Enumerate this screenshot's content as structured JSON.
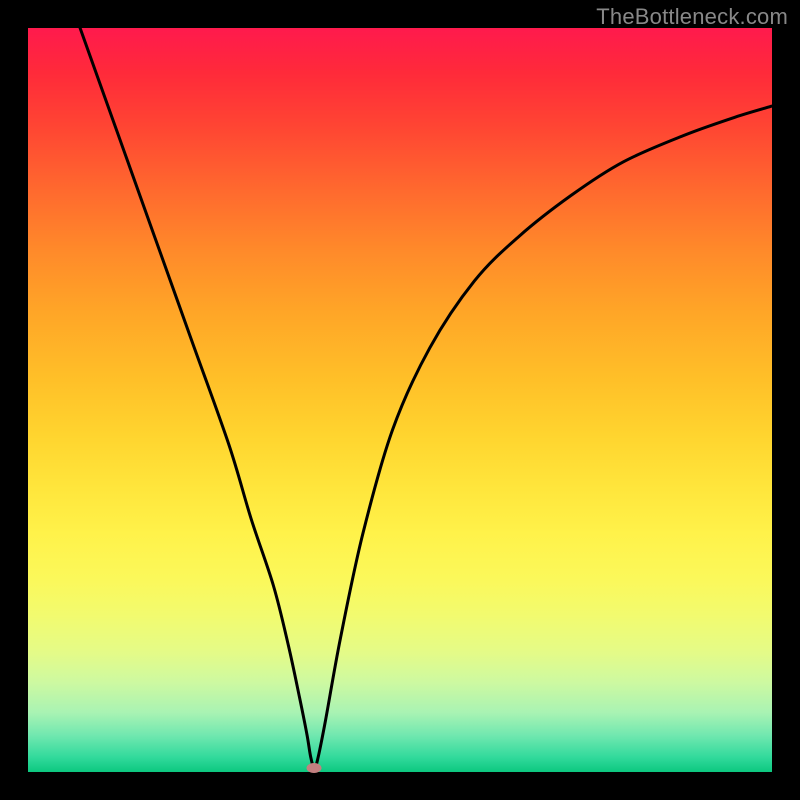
{
  "watermark": "TheBottleneck.com",
  "chart_data": {
    "type": "line",
    "title": "",
    "xlabel": "",
    "ylabel": "",
    "xlim": [
      0,
      100
    ],
    "ylim": [
      0,
      100
    ],
    "series": [
      {
        "name": "curve",
        "x": [
          7,
          12,
          17,
          22,
          27,
          30,
          33,
          35,
          36.5,
          37.5,
          38,
          38.5,
          39,
          40,
          42,
          45,
          49,
          54,
          60,
          66,
          73,
          80,
          88,
          95,
          100
        ],
        "y": [
          100,
          86,
          72,
          58,
          44,
          34,
          25,
          17,
          10,
          5,
          2,
          0.5,
          2,
          7,
          18,
          32,
          46,
          57,
          66,
          72,
          77.5,
          82,
          85.5,
          88,
          89.5
        ]
      }
    ],
    "marker": {
      "x": 38.5,
      "y": 0.5
    },
    "colors": {
      "curve_stroke": "#000000",
      "marker_fill": "#c38080",
      "background_top": "#ff1a4d",
      "background_bottom": "#0cc87f",
      "frame": "#000000"
    }
  }
}
